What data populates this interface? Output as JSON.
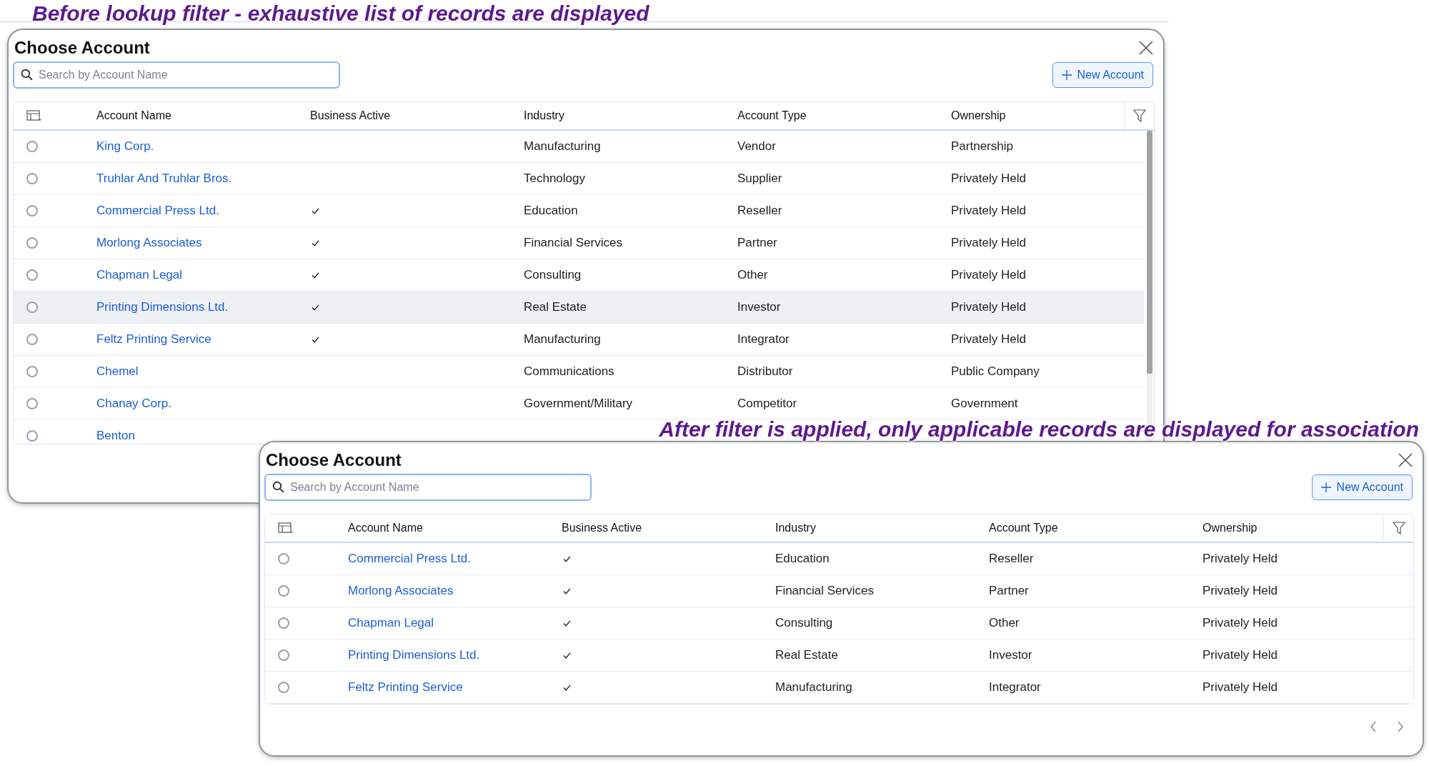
{
  "annotations": [
    {
      "text": "Before lookup filter - exhaustive list of records are displayed"
    },
    {
      "text": "After filter is applied, only applicable records are displayed for association"
    }
  ],
  "dialogs": [
    {
      "title": "Choose Account",
      "search": {
        "placeholder": "Search by Account Name"
      },
      "new_button": "New Account",
      "columns": [
        "Account Name",
        "Business Active",
        "Industry",
        "Account Type",
        "Ownership"
      ],
      "rows": [
        {
          "name": "King Corp.",
          "business_active": false,
          "industry": "Manufacturing",
          "account_type": "Vendor",
          "ownership": "Partnership",
          "selected": false,
          "highlighted": false
        },
        {
          "name": "Truhlar And Truhlar Bros.",
          "business_active": false,
          "industry": "Technology",
          "account_type": "Supplier",
          "ownership": "Privately Held",
          "selected": false,
          "highlighted": false
        },
        {
          "name": "Commercial Press Ltd.",
          "business_active": true,
          "industry": "Education",
          "account_type": "Reseller",
          "ownership": "Privately Held",
          "selected": false,
          "highlighted": false
        },
        {
          "name": "Morlong Associates",
          "business_active": true,
          "industry": "Financial Services",
          "account_type": "Partner",
          "ownership": "Privately Held",
          "selected": false,
          "highlighted": false
        },
        {
          "name": "Chapman Legal",
          "business_active": true,
          "industry": "Consulting",
          "account_type": "Other",
          "ownership": "Privately Held",
          "selected": false,
          "highlighted": false
        },
        {
          "name": "Printing Dimensions Ltd.",
          "business_active": true,
          "industry": "Real Estate",
          "account_type": "Investor",
          "ownership": "Privately Held",
          "selected": false,
          "highlighted": true
        },
        {
          "name": "Feltz Printing Service",
          "business_active": true,
          "industry": "Manufacturing",
          "account_type": "Integrator",
          "ownership": "Privately Held",
          "selected": false,
          "highlighted": false
        },
        {
          "name": "Chemel",
          "business_active": false,
          "industry": "Communications",
          "account_type": "Distributor",
          "ownership": "Public Company",
          "selected": false,
          "highlighted": false
        },
        {
          "name": "Chanay Corp.",
          "business_active": false,
          "industry": "Government/Military",
          "account_type": "Competitor",
          "ownership": "Government",
          "selected": false,
          "highlighted": false
        },
        {
          "name": "Benton",
          "business_active": false,
          "selected": false,
          "highlighted": false
        }
      ]
    },
    {
      "title": "Choose Account",
      "search": {
        "placeholder": "Search by Account Name"
      },
      "new_button": "New Account",
      "columns": [
        "Account Name",
        "Business Active",
        "Industry",
        "Account Type",
        "Ownership"
      ],
      "rows": [
        {
          "name": "Commercial Press Ltd.",
          "business_active": true,
          "industry": "Education",
          "account_type": "Reseller",
          "ownership": "Privately Held",
          "selected": false,
          "highlighted": false
        },
        {
          "name": "Morlong Associates",
          "business_active": true,
          "industry": "Financial Services",
          "account_type": "Partner",
          "ownership": "Privately Held",
          "selected": false,
          "highlighted": false
        },
        {
          "name": "Chapman Legal",
          "business_active": true,
          "industry": "Consulting",
          "account_type": "Other",
          "ownership": "Privately Held",
          "selected": false,
          "highlighted": false
        },
        {
          "name": "Printing Dimensions Ltd.",
          "business_active": true,
          "industry": "Real Estate",
          "account_type": "Investor",
          "ownership": "Privately Held",
          "selected": false,
          "highlighted": false
        },
        {
          "name": "Feltz Printing Service",
          "business_active": true,
          "industry": "Manufacturing",
          "account_type": "Integrator",
          "ownership": "Privately Held",
          "selected": false,
          "highlighted": false
        }
      ],
      "pagination": true
    }
  ]
}
